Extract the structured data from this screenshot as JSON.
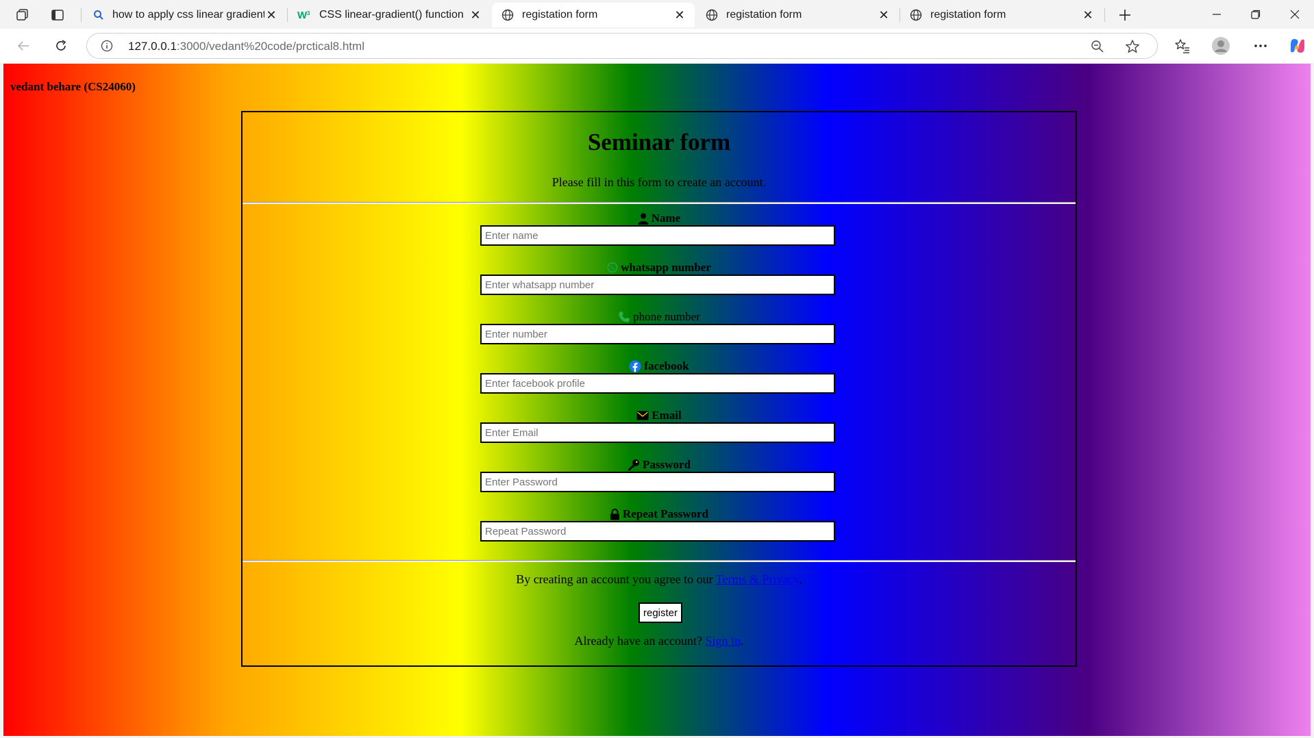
{
  "browser": {
    "tabs": [
      {
        "title": "how to apply css linear gradient b",
        "icon": "search-icon",
        "active": false
      },
      {
        "title": "CSS linear-gradient() function",
        "icon": "w3schools-icon",
        "active": false
      },
      {
        "title": "registation form",
        "icon": "globe-icon",
        "active": true
      },
      {
        "title": "registation form",
        "icon": "globe-icon",
        "active": false
      },
      {
        "title": "registation form",
        "icon": "globe-icon",
        "active": false
      }
    ],
    "url_host": "127.0.0.1",
    "url_path": ":3000/vedant%20code/prctical8.html"
  },
  "page": {
    "author": "vedant behare (CS24060)",
    "gradient_colors": [
      "#ff0000",
      "#ffa500",
      "#ffff00",
      "#008000",
      "#0000ff",
      "#4b0082",
      "#ee82ee"
    ],
    "form": {
      "title": "Seminar form",
      "subtitle": "Please fill in this form to create an account.",
      "fields": [
        {
          "label": "Name",
          "placeholder": "Enter name",
          "icon": "user-icon"
        },
        {
          "label": "whatsapp number",
          "placeholder": "Enter whatsapp number",
          "icon": "whatsapp-icon"
        },
        {
          "label": "phone number",
          "placeholder": "Enter number",
          "icon": "phone-icon"
        },
        {
          "label": "facebook",
          "placeholder": "Enter facebook profile",
          "icon": "facebook-icon"
        },
        {
          "label": "Email",
          "placeholder": "Enter Email",
          "icon": "envelope-icon"
        },
        {
          "label": "Password",
          "placeholder": "Enter Password",
          "icon": "key-icon"
        },
        {
          "label": "Repeat Password",
          "placeholder": "Repeat Password",
          "icon": "lock-icon"
        }
      ],
      "terms_prefix": "By creating an account you agree to our ",
      "terms_link": "Terms & Privacy",
      "terms_suffix": ".",
      "register_label": "register",
      "signin_prefix": "Already have an account? ",
      "signin_link": "Sign in",
      "signin_suffix": "."
    }
  }
}
